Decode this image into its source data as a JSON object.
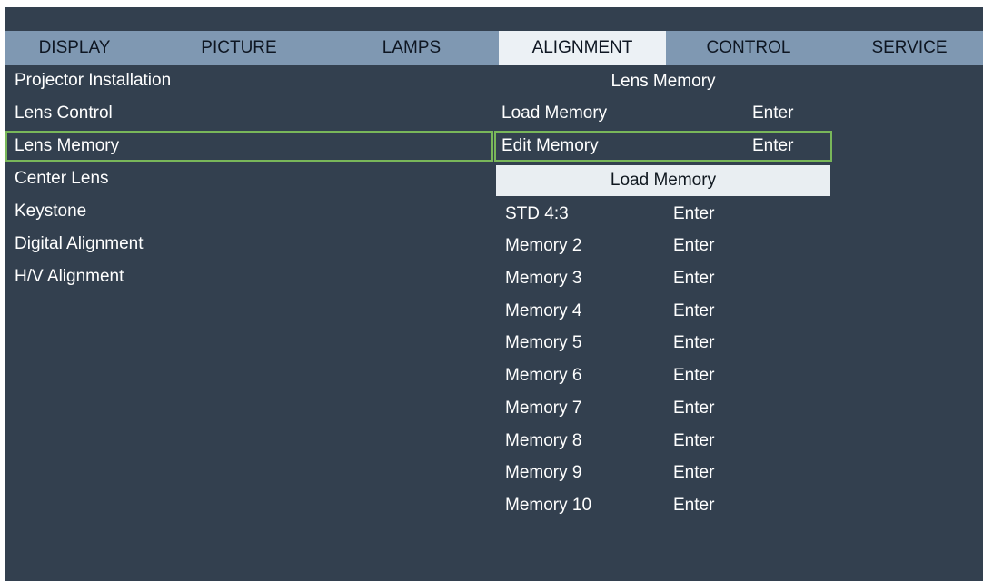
{
  "tabs": [
    {
      "label": "DISPLAY",
      "active": false
    },
    {
      "label": "PICTURE",
      "active": false
    },
    {
      "label": "LAMPS",
      "active": false
    },
    {
      "label": "ALIGNMENT",
      "active": true
    },
    {
      "label": "CONTROL",
      "active": false
    },
    {
      "label": "SERVICE",
      "active": false
    }
  ],
  "left_menu": {
    "items": [
      {
        "label": "Projector Installation",
        "selected": false
      },
      {
        "label": "Lens Control",
        "selected": false
      },
      {
        "label": "Lens Memory",
        "selected": true
      },
      {
        "label": "Center Lens",
        "selected": false
      },
      {
        "label": "Keystone",
        "selected": false
      },
      {
        "label": "Digital Alignment",
        "selected": false
      },
      {
        "label": "H/V Alignment",
        "selected": false
      }
    ]
  },
  "lens_memory": {
    "title": "Lens Memory",
    "rows": [
      {
        "label": "Load Memory",
        "action": "Enter",
        "selected": false
      },
      {
        "label": "Edit Memory",
        "action": "Enter",
        "selected": true
      }
    ]
  },
  "load_memory": {
    "title": "Load Memory",
    "items": [
      {
        "name": "STD 4:3",
        "action": "Enter"
      },
      {
        "name": "Memory 2",
        "action": "Enter"
      },
      {
        "name": "Memory 3",
        "action": "Enter"
      },
      {
        "name": "Memory 4",
        "action": "Enter"
      },
      {
        "name": "Memory 5",
        "action": "Enter"
      },
      {
        "name": "Memory 6",
        "action": "Enter"
      },
      {
        "name": "Memory 7",
        "action": "Enter"
      },
      {
        "name": "Memory 8",
        "action": "Enter"
      },
      {
        "name": "Memory 9",
        "action": "Enter"
      },
      {
        "name": "Memory 10",
        "action": "Enter"
      }
    ]
  },
  "colors": {
    "background": "#33404f",
    "menubar": "#7f98b2",
    "active_tab": "#ecf1f5",
    "selection_border": "#79b75a"
  }
}
